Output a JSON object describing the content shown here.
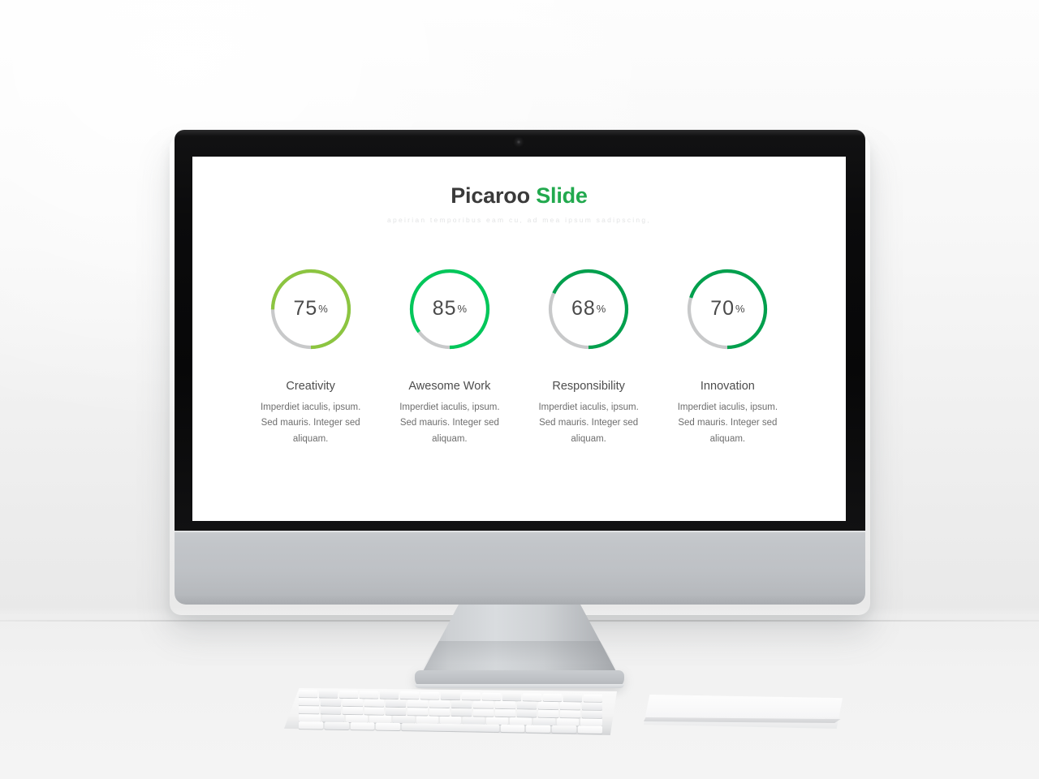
{
  "scene": {
    "device": "desktop-computer-mockup",
    "background_color": "#f2f2f2",
    "desk_color": "#efefef",
    "bezel_color": "#0b0b0c",
    "chin_color": "#bec1c5"
  },
  "slide": {
    "title_main": "Picaroo",
    "title_accent": "Slide",
    "accent_color": "#22a94e",
    "subtitle": "apeirian temporibus eam cu, ad mea ipsum sadipscing,",
    "background_color": "#ffffff"
  },
  "cards": [
    {
      "title": "Creativity",
      "value": 75,
      "value_label": "75",
      "percent_symbol": "%",
      "color": "#8cc540",
      "track_color": "#c8c9ca",
      "body": "Imperdiet iaculis, ipsum. Sed mauris. Integer sed aliquam."
    },
    {
      "title": "Awesome Work",
      "value": 85,
      "value_label": "85",
      "percent_symbol": "%",
      "color": "#00c75a",
      "track_color": "#c8c9ca",
      "body": "Imperdiet iaculis, ipsum. Sed mauris. Integer sed aliquam."
    },
    {
      "title": "Responsibility",
      "value": 68,
      "value_label": "68",
      "percent_symbol": "%",
      "color": "#00a04d",
      "track_color": "#c8c9ca",
      "body": "Imperdiet iaculis, ipsum. Sed mauris. Integer sed aliquam."
    },
    {
      "title": "Innovation",
      "value": 70,
      "value_label": "70",
      "percent_symbol": "%",
      "color": "#00a04d",
      "track_color": "#c8c9ca",
      "body": "Imperdiet iaculis, ipsum. Sed mauris. Integer sed aliquam."
    }
  ],
  "chart_data": {
    "type": "bar",
    "title": "Picaroo Slide",
    "subtitle": "apeirian temporibus eam cu, ad mea ipsum sadipscing,",
    "categories": [
      "Creativity",
      "Awesome Work",
      "Responsibility",
      "Innovation"
    ],
    "values": [
      75,
      85,
      68,
      70
    ],
    "value_unit": "%",
    "ylim": [
      0,
      100
    ],
    "xlabel": "",
    "ylabel": "",
    "grid": false,
    "legend": "none",
    "series_colors": [
      "#8cc540",
      "#00c75a",
      "#00a04d",
      "#00a04d"
    ],
    "render_style": "donut-gauges"
  },
  "peripherals": {
    "keyboard_label": "keyboard",
    "trackpad_label": "trackpad"
  }
}
